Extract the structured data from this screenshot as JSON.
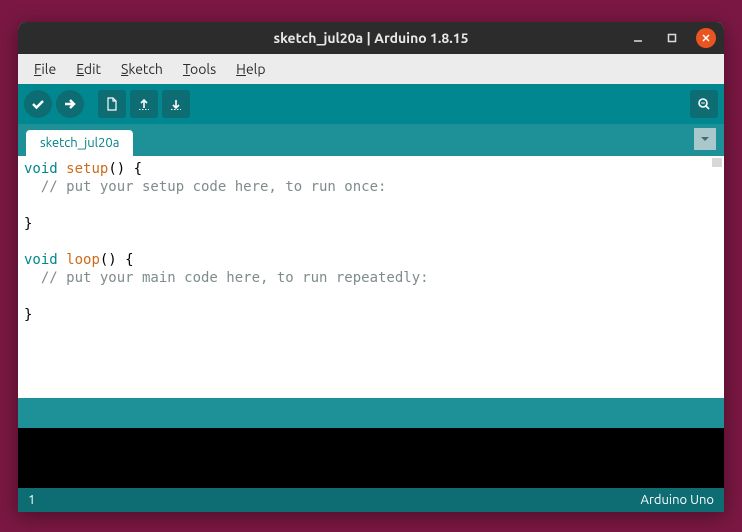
{
  "titlebar": {
    "title": "sketch_jul20a | Arduino 1.8.15"
  },
  "menu": {
    "file": "File",
    "edit": "Edit",
    "sketch": "Sketch",
    "tools": "Tools",
    "help": "Help"
  },
  "tab": {
    "name": "sketch_jul20a"
  },
  "code": {
    "l1a": "void",
    "l1b": " ",
    "l1c": "setup",
    "l1d": "() {",
    "l2": "  // put your setup code here, to run once:",
    "l3": "",
    "l4": "}",
    "l5": "",
    "l6a": "void",
    "l6b": " ",
    "l6c": "loop",
    "l6d": "() {",
    "l7": "  // put your main code here, to run repeatedly:",
    "l8": "",
    "l9": "}"
  },
  "footer": {
    "line": "1",
    "board": "Arduino Uno"
  }
}
